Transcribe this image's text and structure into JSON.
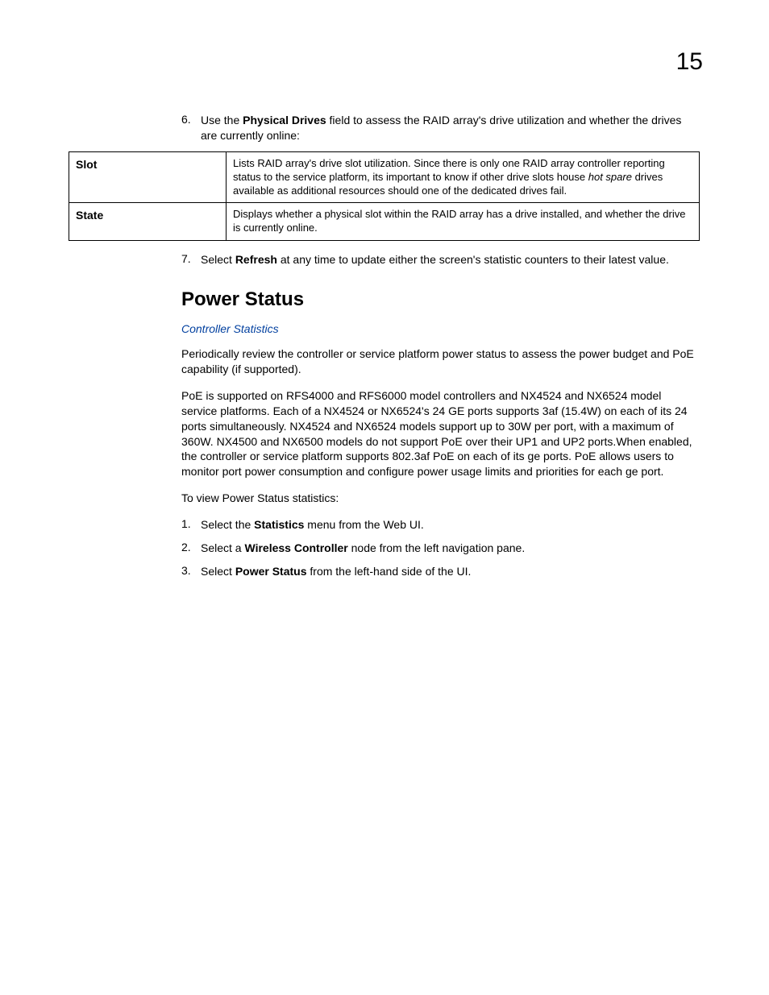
{
  "page_number": "15",
  "step6": {
    "num": "6.",
    "pre": "Use the ",
    "bold": "Physical Drives",
    "post": " field to assess the RAID array's drive utilization and whether the drives are currently online:"
  },
  "table": {
    "slot_label": "Slot",
    "slot_desc_pre": "Lists RAID array's drive slot utilization. Since there is only one RAID array controller reporting status to the service platform, its important to know if other drive slots house ",
    "slot_desc_italic": "hot spare",
    "slot_desc_post": " drives available as additional resources should one of the dedicated drives fail.",
    "state_label": "State",
    "state_desc": "Displays whether a physical slot within the RAID array has a drive installed, and whether the drive is currently online."
  },
  "step7": {
    "num": "7.",
    "pre": "Select ",
    "bold": "Refresh",
    "post": " at any time to update either the screen's statistic counters to their latest value."
  },
  "section_title": "Power Status",
  "link": "Controller Statistics",
  "para1": "Periodically review the controller or service platform power status to assess the power budget and PoE capability (if supported).",
  "para2": "PoE is supported on RFS4000 and RFS6000 model controllers and NX4524 and NX6524 model service platforms. Each of a NX4524 or NX6524's 24 GE ports supports 3af (15.4W) on each of its 24 ports simultaneously. NX4524 and NX6524 models support up to 30W per port, with a maximum of 360W. NX4500 and NX6500 models do not support PoE over their UP1 and UP2 ports.When enabled, the controller or service platform supports 802.3af PoE on each of its ge ports. PoE allows users to monitor port power consumption and configure power usage limits and priorities for each ge port.",
  "para3": "To view Power Status statistics:",
  "ps1": {
    "num": "1.",
    "pre": "Select the ",
    "bold": "Statistics",
    "post": " menu from the Web UI."
  },
  "ps2": {
    "num": "2.",
    "pre": "Select a ",
    "bold": "Wireless Controller",
    "post": " node from the left navigation pane."
  },
  "ps3": {
    "num": "3.",
    "pre": "Select ",
    "bold": "Power Status",
    "post": " from the left-hand side of the UI."
  }
}
